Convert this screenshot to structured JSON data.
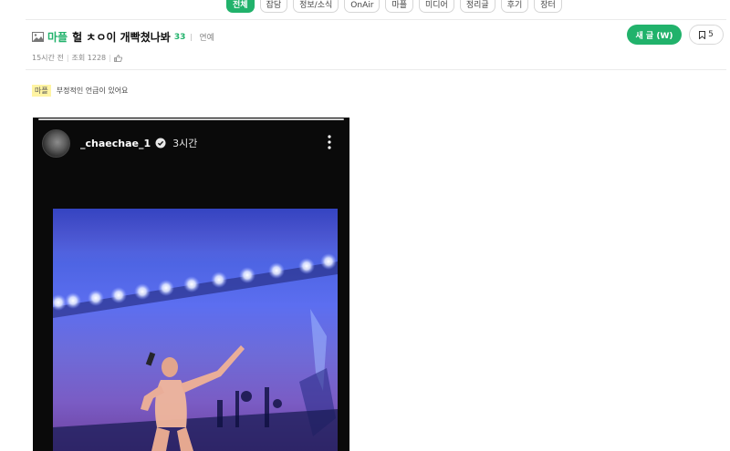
{
  "nav": {
    "tabs": [
      {
        "label": "전체",
        "active": true
      },
      {
        "label": "잡담",
        "active": false
      },
      {
        "label": "정보/소식",
        "active": false
      },
      {
        "label": "OnAir",
        "active": false
      },
      {
        "label": "마플",
        "active": false
      },
      {
        "label": "미디어",
        "active": false
      },
      {
        "label": "정리글",
        "active": false
      },
      {
        "label": "후기",
        "active": false
      },
      {
        "label": "장터",
        "active": false
      }
    ]
  },
  "post": {
    "board": "마플",
    "title": "헐 ㅊㅇ이 개빡쳤나봐",
    "comment_count": "33",
    "category": "연예",
    "time_ago": "15시간 전",
    "views_label": "조회 1228",
    "write_button": "새 글 (W)",
    "bookmark_count": "5",
    "notice_tag": "마플",
    "notice_text": "부정적인 언급이 있어요"
  },
  "story": {
    "username": "_chaechae_1",
    "time": "3시간"
  },
  "colors": {
    "accent": "#21b26b",
    "notice_bg": "#fff4a3"
  }
}
